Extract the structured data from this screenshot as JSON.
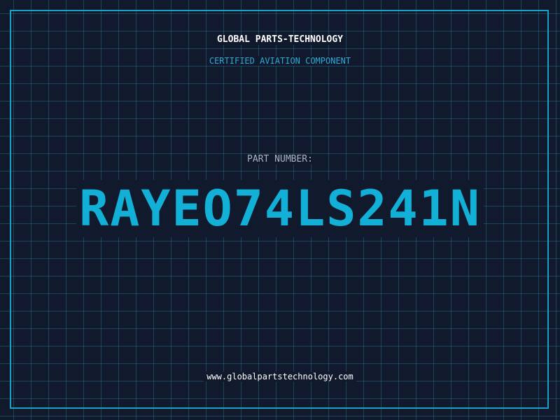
{
  "brand": "GLOBAL PARTS-TECHNOLOGY",
  "tagline": "CERTIFIED AVIATION COMPONENT",
  "part_label": "PART NUMBER:",
  "part_number": "RAYEO74LS241N",
  "website": "www.globalpartstechnology.com",
  "colors": {
    "background": "#111a2c",
    "grid": "#28789a",
    "frame": "#1a9fc8",
    "accent": "#12afd6",
    "label": "#aab4c4",
    "text": "#ffffff"
  }
}
